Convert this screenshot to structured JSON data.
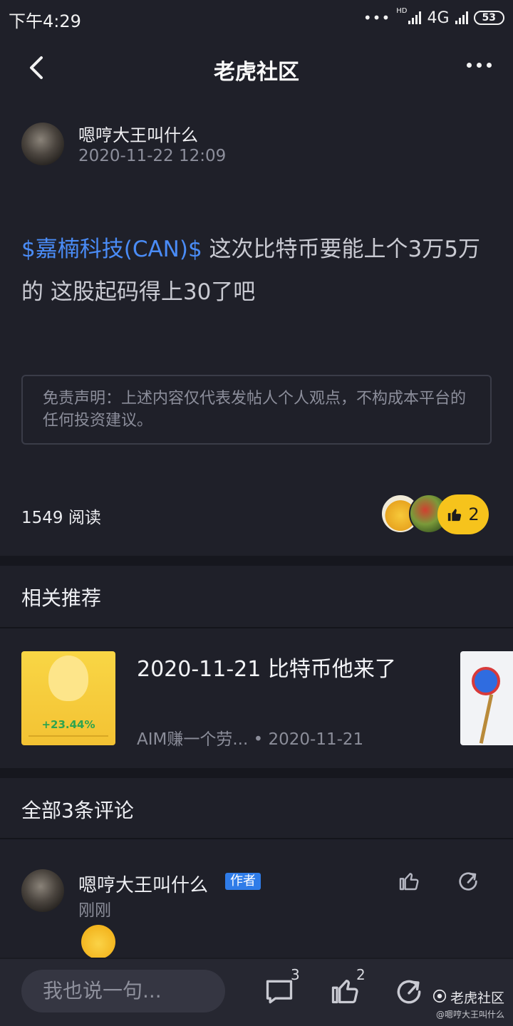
{
  "status_bar": {
    "time": "下午4:29",
    "network": "4G",
    "hd_label": "HD",
    "battery": "53"
  },
  "nav": {
    "title": "老虎社区"
  },
  "post": {
    "author": "嗯哼大王叫什么",
    "time": "2020-11-22 12:09",
    "stock_link": "$嘉楠科技(CAN)$",
    "text": " 这次比特币要能上个3万5万的 这股起码得上30了吧",
    "disclaimer": "免责声明：上述内容仅代表发帖人个人观点，不构成本平台的任何投资建议。",
    "read_count": "1549 阅读",
    "like_count": "2"
  },
  "related": {
    "section_title": "相关推荐",
    "items": [
      {
        "title": "2020-11-21 比特币他来了",
        "meta": "AIM赚一个劳... • 2020-11-21",
        "thumb_percent": "+23.44%"
      }
    ]
  },
  "comments": {
    "section_title": "全部3条评论",
    "items": [
      {
        "author": "嗯哼大王叫什么",
        "badge": "作者",
        "time": "刚刚"
      }
    ]
  },
  "bottom_bar": {
    "input_placeholder": "我也说一句...",
    "comment_count": "3",
    "like_count": "2"
  },
  "watermark": {
    "title": "老虎社区",
    "user": "@嗯哼大王叫什么"
  },
  "colors": {
    "background": "#1f2029",
    "accent_link": "#4a8cf7",
    "like_yellow": "#f6c31c",
    "badge_blue": "#2f7ce8"
  }
}
